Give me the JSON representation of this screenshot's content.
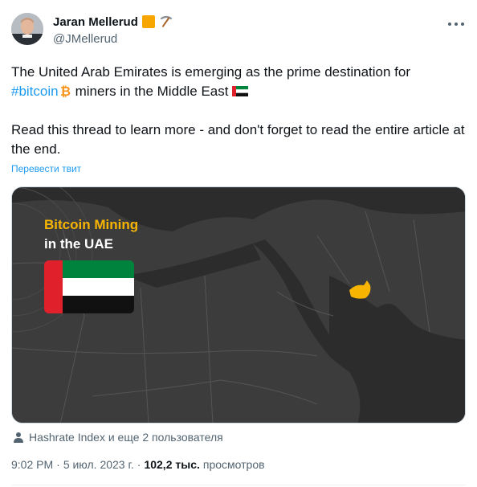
{
  "author": {
    "display_name": "Jaran Mellerud",
    "handle": "@JMellerud",
    "avatar_icon": "avatar-photo",
    "badges": [
      "orange-square-icon",
      "pickaxe-icon"
    ]
  },
  "tweet": {
    "line1": "The United Arab Emirates is emerging as the prime destination for",
    "hashtag": "#bitcoin",
    "line2_rest": "miners in the Middle East",
    "paragraph2": "Read this thread to learn more - and don't forget to read the entire article at the end.",
    "icons": [
      "bitcoin-icon",
      "uae-flag-icon"
    ]
  },
  "translate_label": "Перевести твит",
  "media": {
    "title_line1": "Bitcoin Mining",
    "title_line2": "in the UAE",
    "accent_color": "#f7b500",
    "background_color": "#3a3a3a"
  },
  "tagged": {
    "label": "Hashrate Index и еще 2 пользователя"
  },
  "meta": {
    "time": "9:02 PM",
    "separator": "·",
    "date": "5 июл. 2023 г.",
    "views_count": "102,2 тыс.",
    "views_label": "просмотров"
  },
  "colors": {
    "link": "#1d9bf0",
    "secondary_text": "#536471",
    "primary_text": "#0f1419",
    "bitcoin_orange": "#f7931a"
  }
}
